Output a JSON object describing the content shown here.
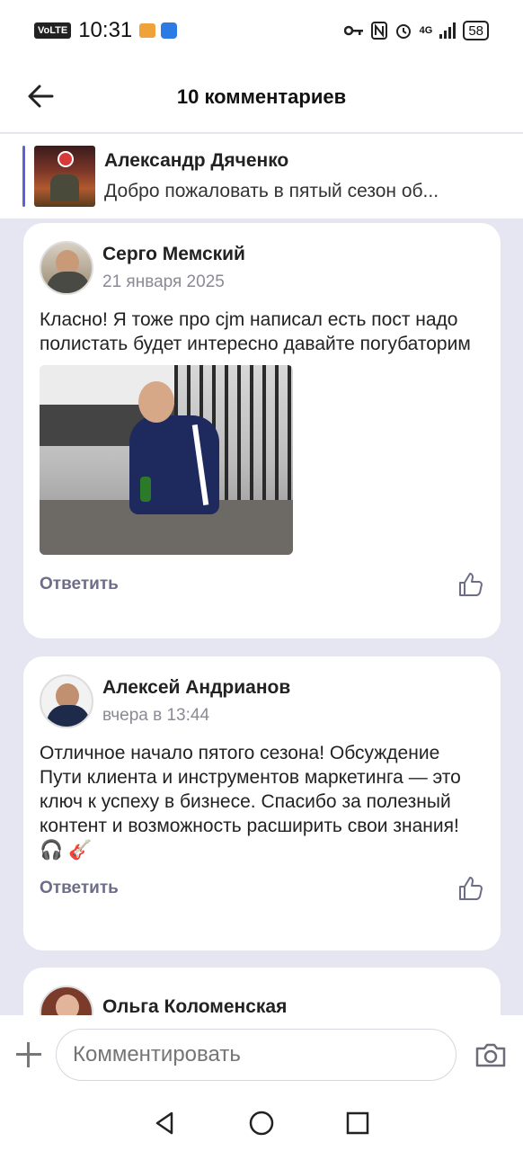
{
  "status_bar": {
    "time": "10:31",
    "volte": "VoLTE",
    "network": "4G",
    "battery": "58"
  },
  "header": {
    "title": "10 комментариев"
  },
  "post_preview": {
    "author": "Александр Дяченко",
    "text": "Добро пожаловать в пятый сезон об..."
  },
  "comments": [
    {
      "author": "Серго Мемский",
      "date": "21 января 2025",
      "text": "Класно! Я тоже про cjm написал есть пост надо полистать будет интересно давайте погубаторим",
      "reply_label": "Ответить"
    },
    {
      "author": "Алексей Андрианов",
      "date": "вчера в 13:44",
      "text": "Отличное начало пятого сезона! Обсуждение Пути клиента и инструментов маркетинга — это ключ к успеху в бизнесе. Спасибо за полезный контент и возможность расширить свои знания! 🎧 🎸",
      "reply_label": "Ответить"
    },
    {
      "author": "Ольга Коломенская"
    }
  ],
  "input": {
    "placeholder": "Комментировать"
  },
  "colors": {
    "accent": "#5b62d6",
    "background": "#e6e6f3",
    "reply": "#6d6d8a"
  },
  "icons": [
    "back-arrow-icon",
    "like-icon",
    "plus-icon",
    "camera-icon",
    "nav-back-icon",
    "nav-home-icon",
    "nav-recents-icon"
  ]
}
